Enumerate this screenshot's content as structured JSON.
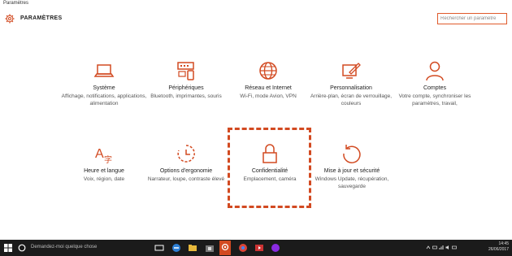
{
  "window": {
    "title": "Paramètres"
  },
  "header": {
    "app_title": "PARAMÈTRES",
    "search_placeholder": "Rechercher un paramètre"
  },
  "tiles": [
    {
      "title": "Système",
      "desc": "Affichage, notifications, applications, alimentation",
      "icon": "laptop-icon"
    },
    {
      "title": "Périphériques",
      "desc": "Bluetooth, imprimantes, souris",
      "icon": "devices-icon"
    },
    {
      "title": "Réseau et Internet",
      "desc": "Wi-Fi, mode Avion, VPN",
      "icon": "globe-icon"
    },
    {
      "title": "Personnalisation",
      "desc": "Arrière-plan, écran de verrouillage, couleurs",
      "icon": "paint-icon"
    },
    {
      "title": "Comptes",
      "desc": "Votre compte, synchroniser les paramètres, travail,",
      "icon": "person-icon"
    },
    {
      "title": "Heure et langue",
      "desc": "Voix, région, date",
      "icon": "time-language-icon"
    },
    {
      "title": "Options d'ergonomie",
      "desc": "Narrateur, loupe, contraste élevé",
      "icon": "ease-of-access-icon"
    },
    {
      "title": "Confidentialité",
      "desc": "Emplacement, caméra",
      "icon": "lock-icon"
    },
    {
      "title": "Mise à jour et sécurité",
      "desc": "Windows Update, récupération, sauvegarde",
      "icon": "update-icon"
    }
  ],
  "taskbar": {
    "search_text": "Demandez-moi quelque chose",
    "time": "14:45",
    "date": "26/06/2017"
  },
  "colors": {
    "accent": "#d24a21",
    "taskbar": "#1b1b1b"
  }
}
